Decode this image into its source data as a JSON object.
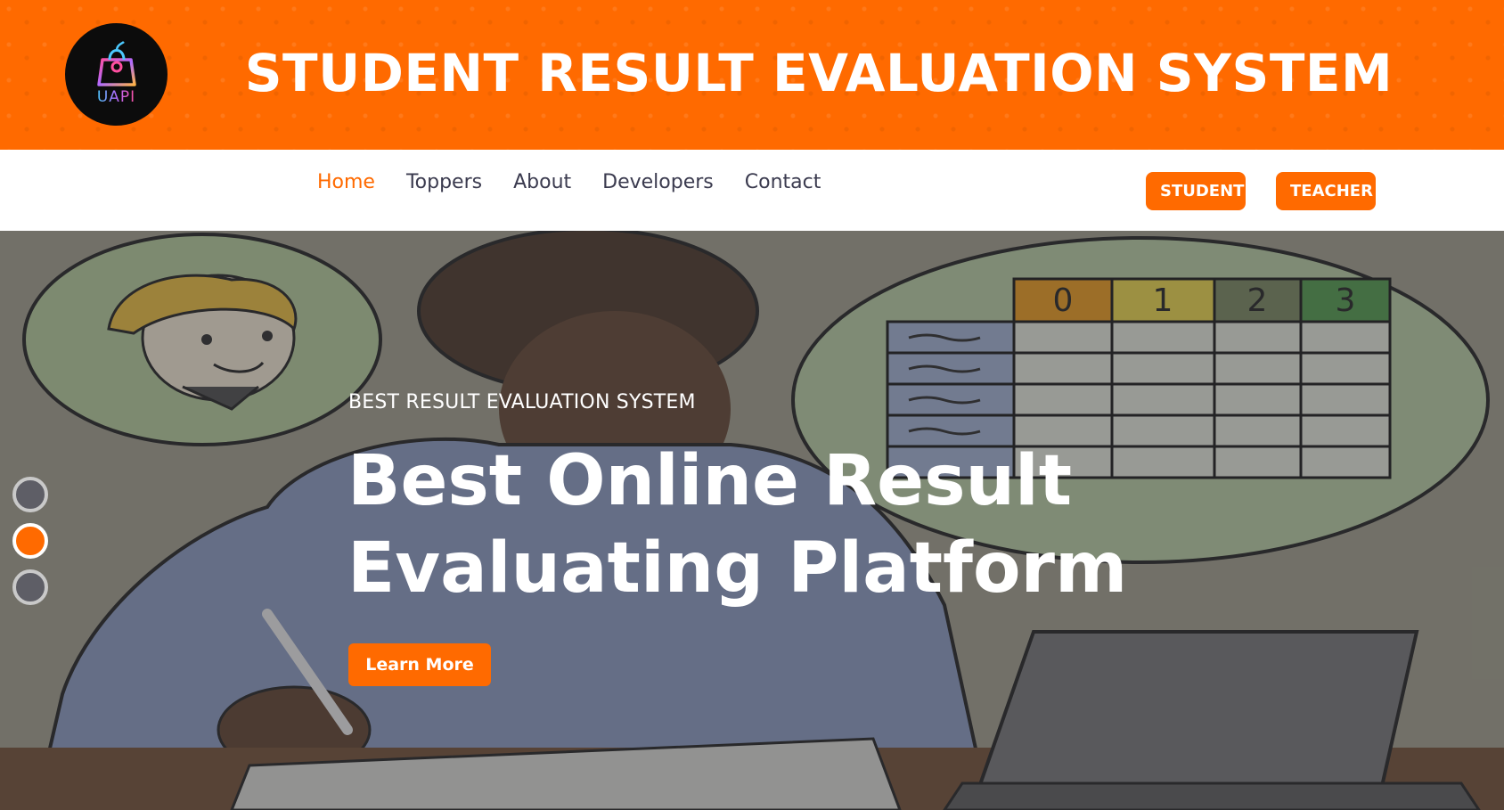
{
  "brand": {
    "logo_text": "UAPI",
    "title": "STUDENT RESULT EVALUATION SYSTEM"
  },
  "nav": {
    "links": [
      {
        "label": "Home",
        "active": true
      },
      {
        "label": "Toppers",
        "active": false
      },
      {
        "label": "About",
        "active": false
      },
      {
        "label": "Developers",
        "active": false
      },
      {
        "label": "Contact",
        "active": false
      }
    ],
    "student_label": "STUDENT",
    "teacher_label": "TEACHER"
  },
  "hero": {
    "subtitle": "BEST RESULT EVALUATION SYSTEM",
    "title_line1": "Best Online Result",
    "title_line2": "Evaluating Platform",
    "button_label": "Learn More",
    "slides_total": 3,
    "active_slide": 2,
    "chart_headers": [
      "0",
      "1",
      "2",
      "3"
    ]
  },
  "colors": {
    "accent": "#ff6a00",
    "nav_text": "#3b3b4f",
    "white": "#ffffff"
  }
}
